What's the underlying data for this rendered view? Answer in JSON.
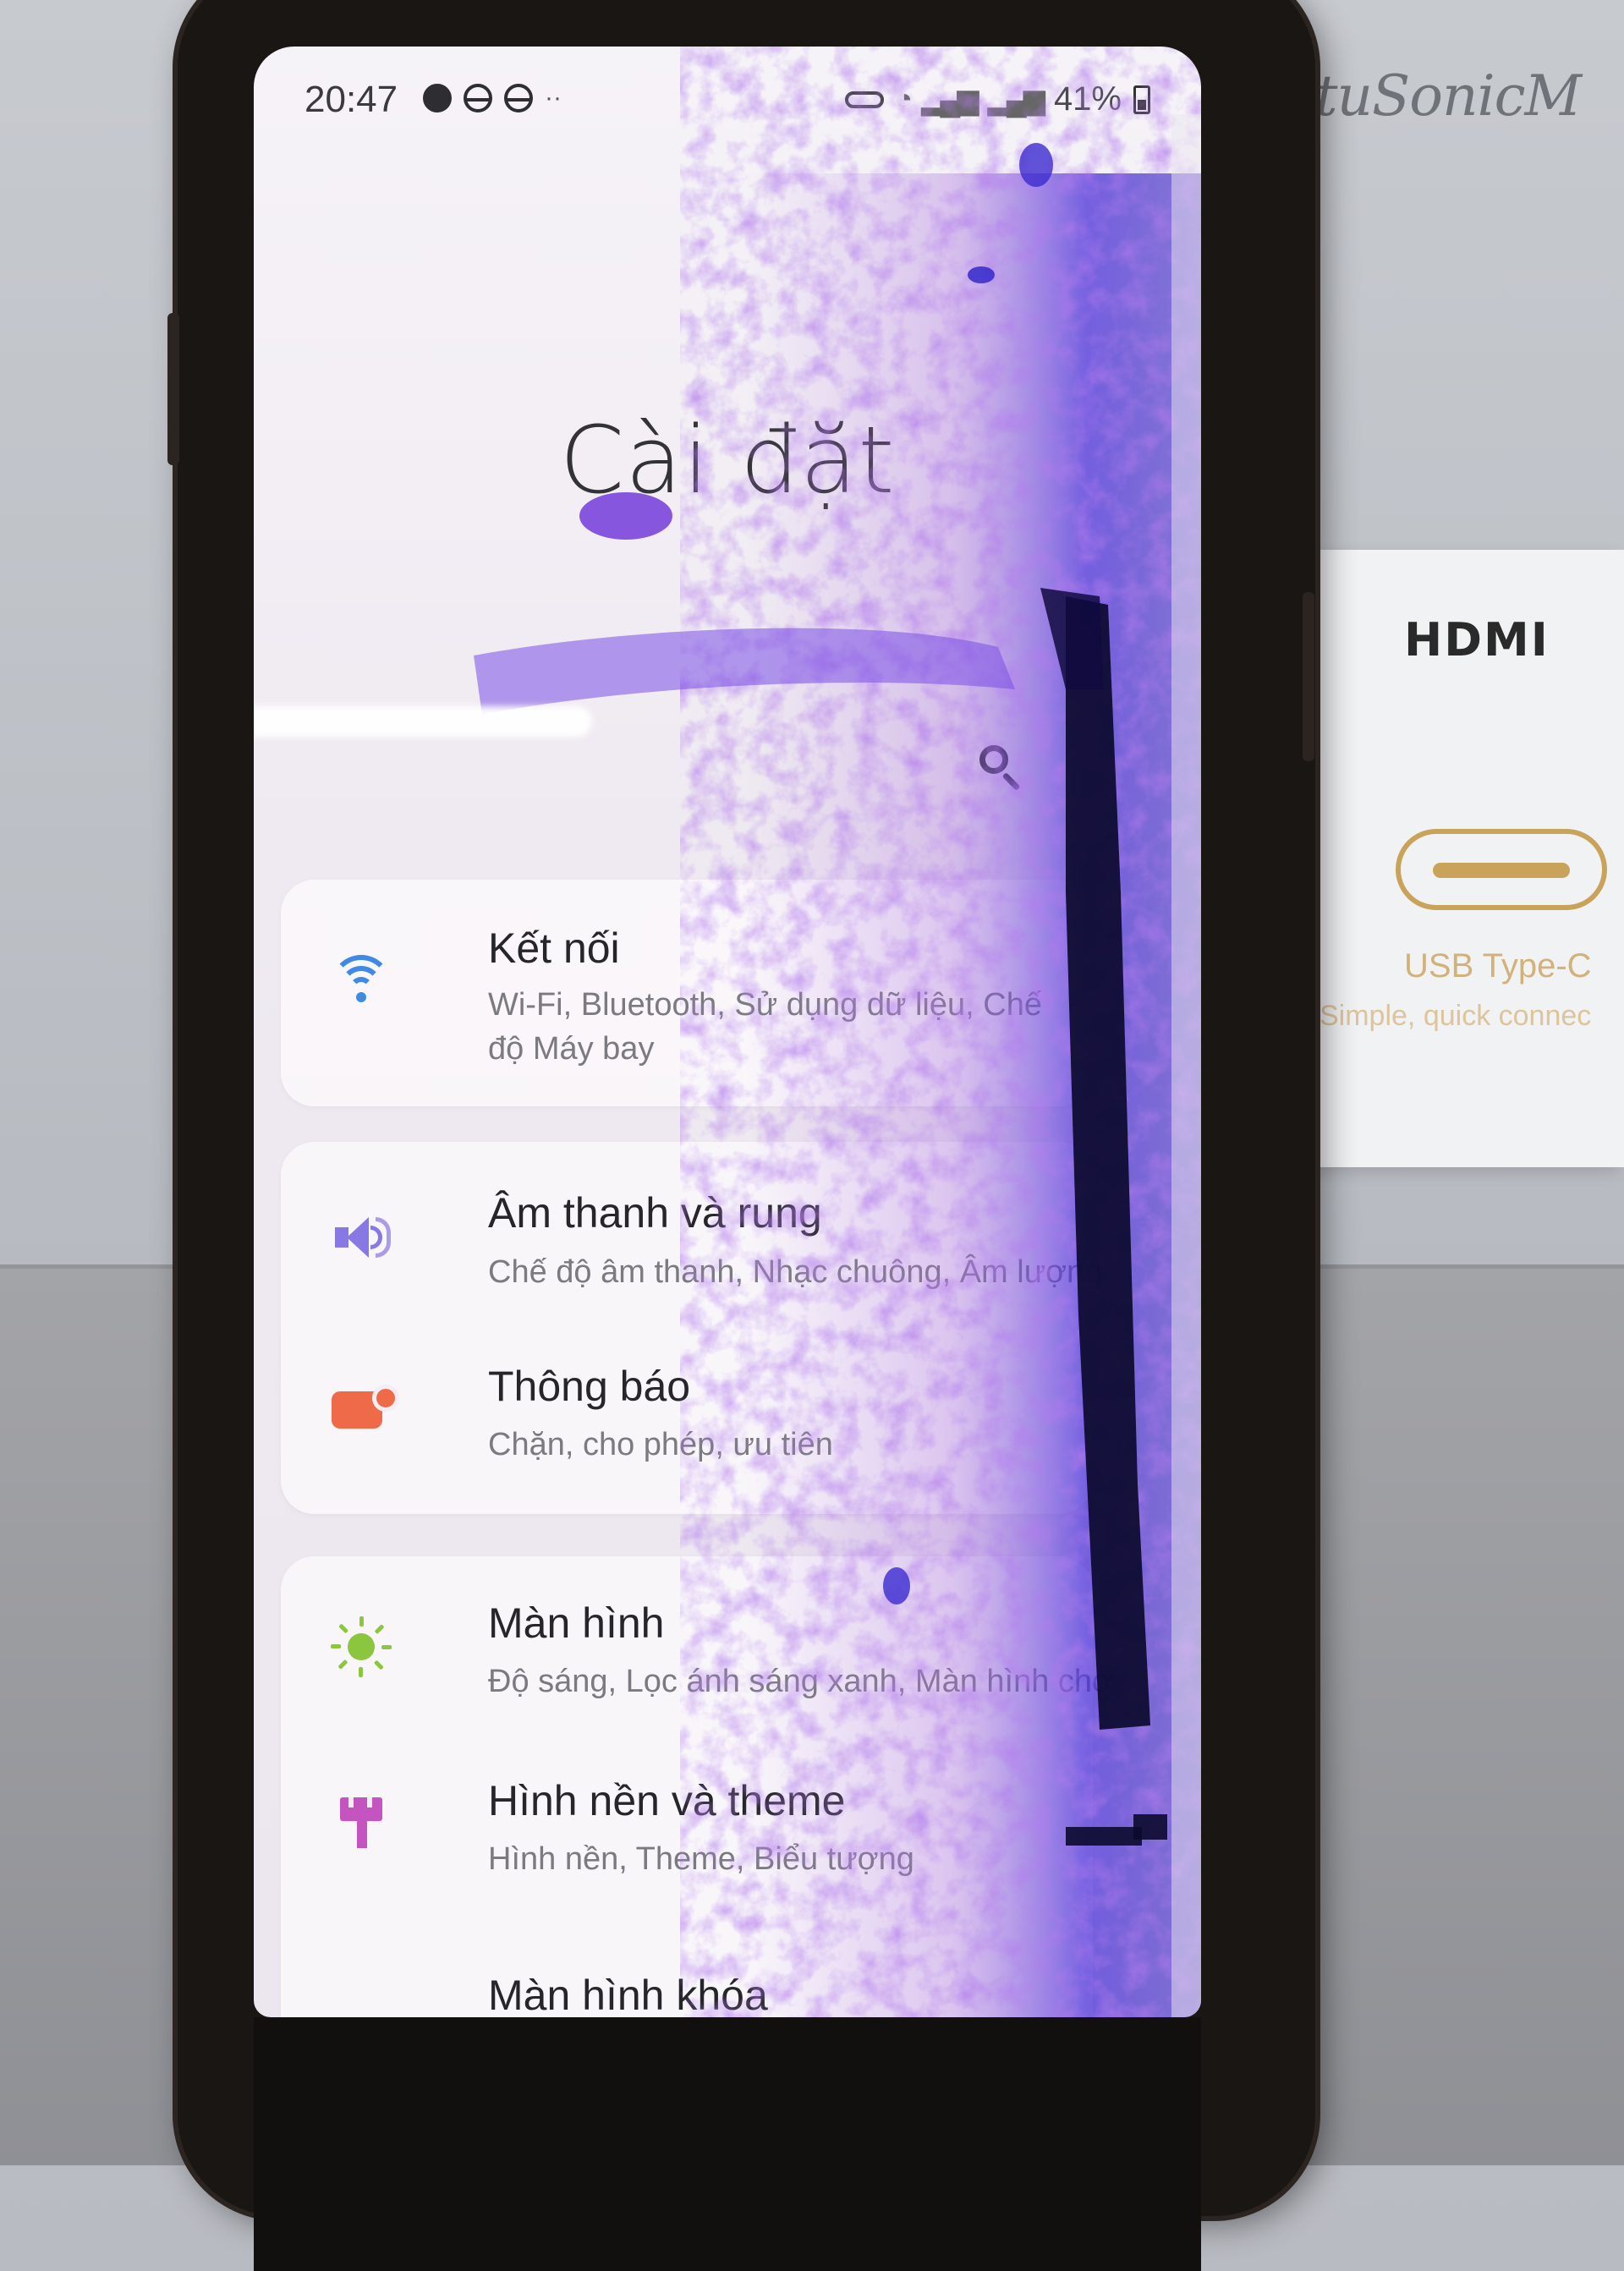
{
  "backdrop": {
    "brand_script": "tuSonicM",
    "box": {
      "hdmi": "HDMI",
      "port_label": "USB Type-C",
      "tagline": "Simple, quick connec"
    }
  },
  "status_bar": {
    "time": "20:47",
    "left_icons": [
      "messenger-icon",
      "half-circle-icon",
      "half-circle-icon"
    ],
    "more": "··",
    "battery_percent": "41%"
  },
  "header": {
    "title": "Cài đặt"
  },
  "settings": [
    {
      "title": "Kết nối",
      "subtitle": "Wi-Fi, Bluetooth, Sử dụng dữ liệu, Chế độ Máy bay",
      "icon": "wifi-icon",
      "color": "#3f8ae6"
    },
    {
      "title": "Âm thanh và rung",
      "subtitle": "Chế độ âm thanh, Nhạc chuông, Âm lượng",
      "icon": "speaker-icon",
      "color": "#8878e4"
    },
    {
      "title": "Thông báo",
      "subtitle": "Chặn, cho phép, ưu tiên",
      "icon": "notification-icon",
      "color": "#ef6a48"
    },
    {
      "title": "Màn hình",
      "subtitle": "Độ sáng, Lọc ánh sáng xanh, Màn hình chờ",
      "icon": "brightness-icon",
      "color": "#8cc63f"
    },
    {
      "title": "Hình nền và theme",
      "subtitle": "Hình nền, Theme, Biểu tượng",
      "icon": "paintbrush-icon",
      "color": "#c455c0"
    },
    {
      "title": "Màn hình khóa",
      "subtitle": "",
      "icon": "lock-screen-icon",
      "color": "#8878e4"
    }
  ]
}
